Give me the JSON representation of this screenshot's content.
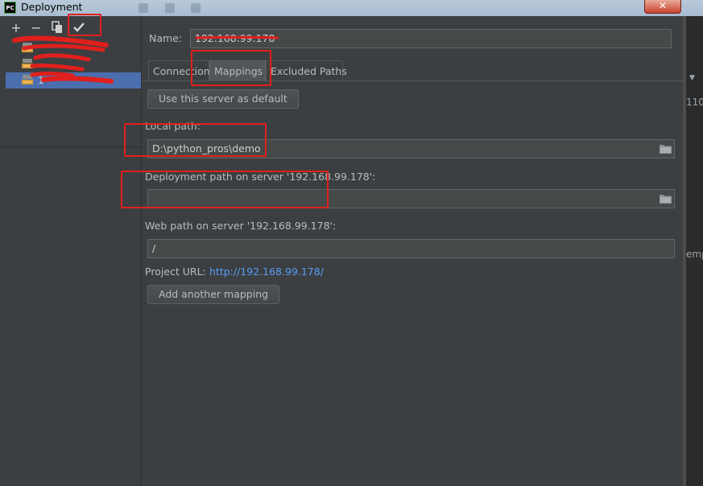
{
  "window": {
    "title": "Deployment",
    "app_icon_text": "PC",
    "close_glyph": "✕"
  },
  "toolbar": {
    "add_glyph": "+",
    "remove_glyph": "−",
    "copy_glyph": "⧉",
    "check_glyph": "✓"
  },
  "servers": {
    "items": [
      {
        "label": "",
        "selected": false
      },
      {
        "label": "",
        "selected": false
      },
      {
        "label": "1",
        "selected": true
      }
    ]
  },
  "form": {
    "name_label": "Name:",
    "name_value": "192.168.99.178",
    "tabs": [
      "Connection",
      "Mappings",
      "Excluded Paths"
    ],
    "active_tab": "Mappings",
    "default_button": "Use this server as default",
    "local_path_label": "Local path:",
    "local_path_value": "D:\\python_pros\\demo",
    "deploy_path_label": "Deployment path on server '192.168.99.178':",
    "deploy_path_value": "",
    "web_path_label": "Web path on server '192.168.99.178':",
    "web_path_value": "/",
    "project_url_label": "Project URL:",
    "project_url_value": "http://192.168.99.178/",
    "add_mapping_button": "Add another mapping"
  },
  "background_peek": {
    "text_1": "110",
    "text_2": "emp",
    "arrow": "▼"
  },
  "colors": {
    "panel_bg": "#3c3f41",
    "selection": "#4b6eaf",
    "annotation_red": "#e0201c",
    "link": "#589df6"
  },
  "icons": [
    "app-icon",
    "close-icon",
    "add-icon",
    "remove-icon",
    "copy-icon",
    "check-icon",
    "sftp-server-icon",
    "folder-icon"
  ]
}
